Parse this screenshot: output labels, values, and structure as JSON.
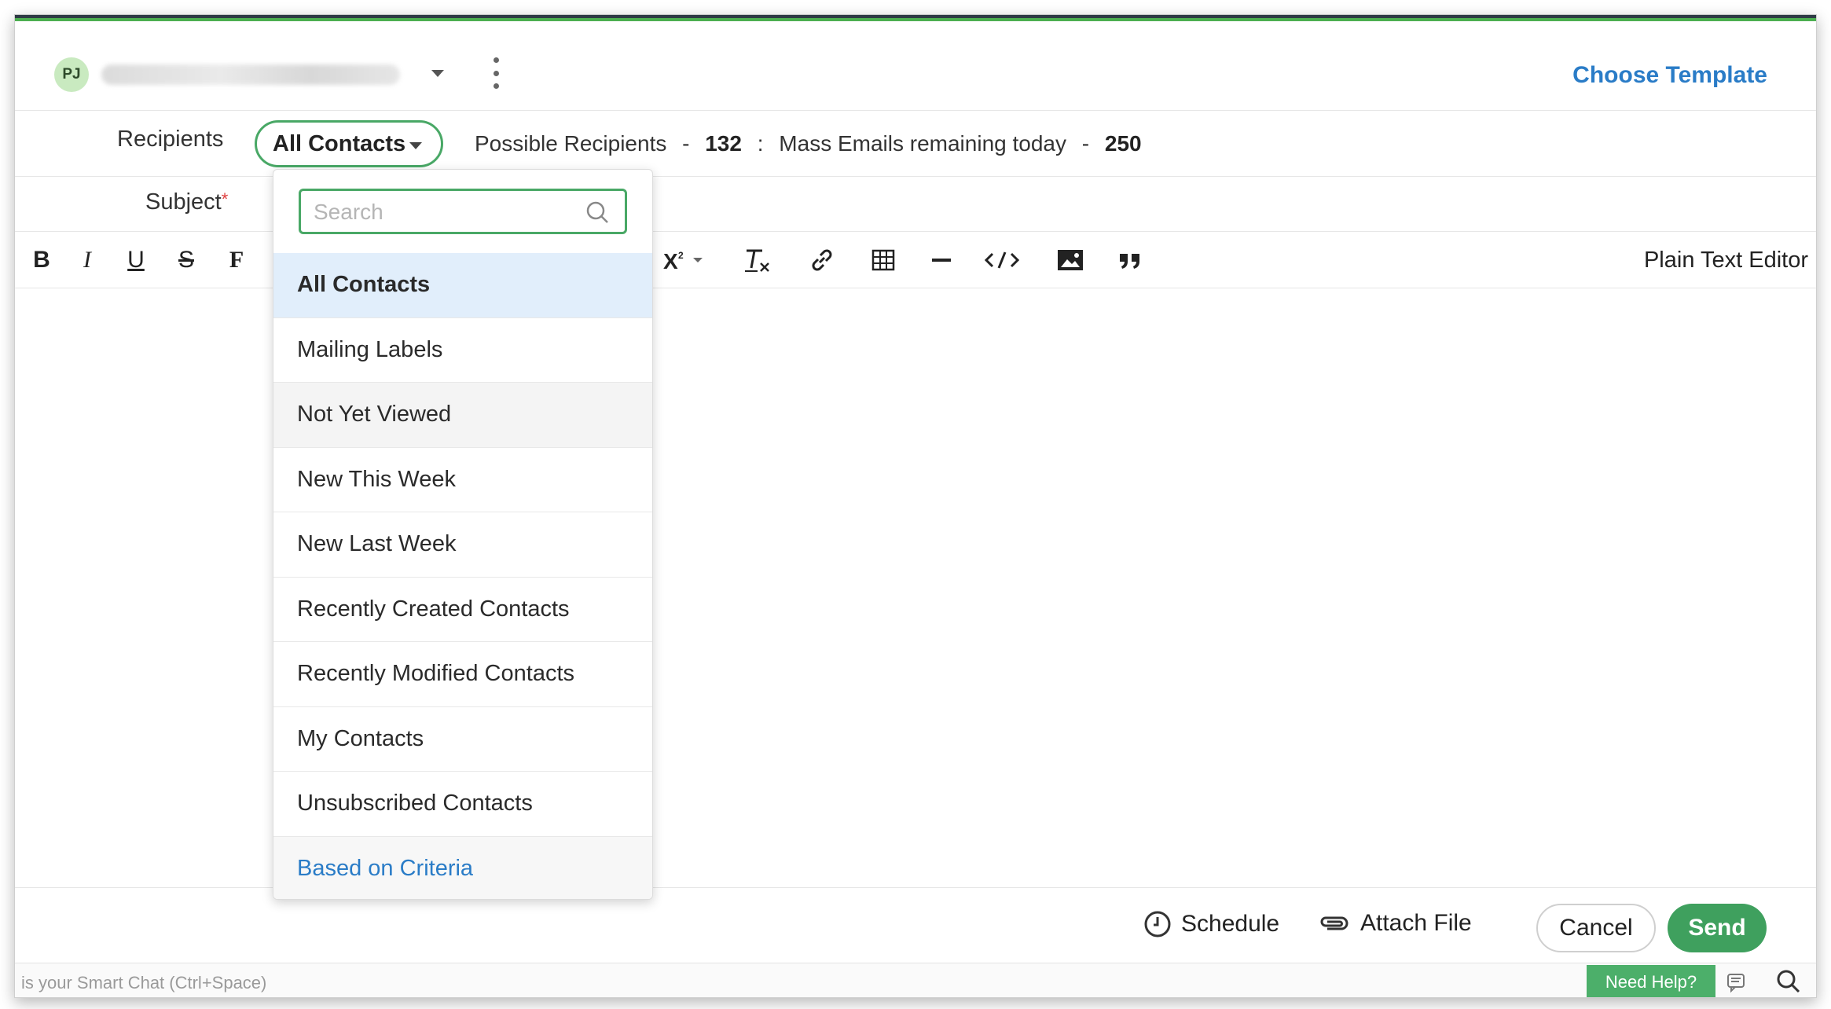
{
  "header": {
    "avatar_initials": "PJ",
    "choose_template": "Choose Template"
  },
  "recipients": {
    "label": "Recipients",
    "selected": "All Contacts",
    "possible_label": "Possible Recipients",
    "possible_count": "132",
    "mass_label": "Mass Emails remaining today",
    "mass_count": "250"
  },
  "subject": {
    "label": "Subject",
    "required_marker": "*"
  },
  "toolbar": {
    "bold": "B",
    "italic": "I",
    "underline": "U",
    "strike": "S",
    "font": "F",
    "plain_text_editor": "Plain Text Editor"
  },
  "dropdown": {
    "search_placeholder": "Search",
    "items": [
      "All Contacts",
      "Mailing Labels",
      "Not Yet Viewed",
      "New This Week",
      "New Last Week",
      "Recently Created Contacts",
      "Recently Modified Contacts",
      "My Contacts",
      "Unsubscribed Contacts"
    ],
    "criteria": "Based on Criteria"
  },
  "footer": {
    "schedule": "Schedule",
    "attach_file": "Attach File",
    "cancel": "Cancel",
    "send": "Send"
  },
  "chatbar": {
    "hint": "is your Smart Chat (Ctrl+Space)",
    "need_help": "Need Help?"
  },
  "colors": {
    "accent_green": "#49a866",
    "link_blue": "#2a7cc7",
    "selected_bg": "#e1eefb"
  }
}
